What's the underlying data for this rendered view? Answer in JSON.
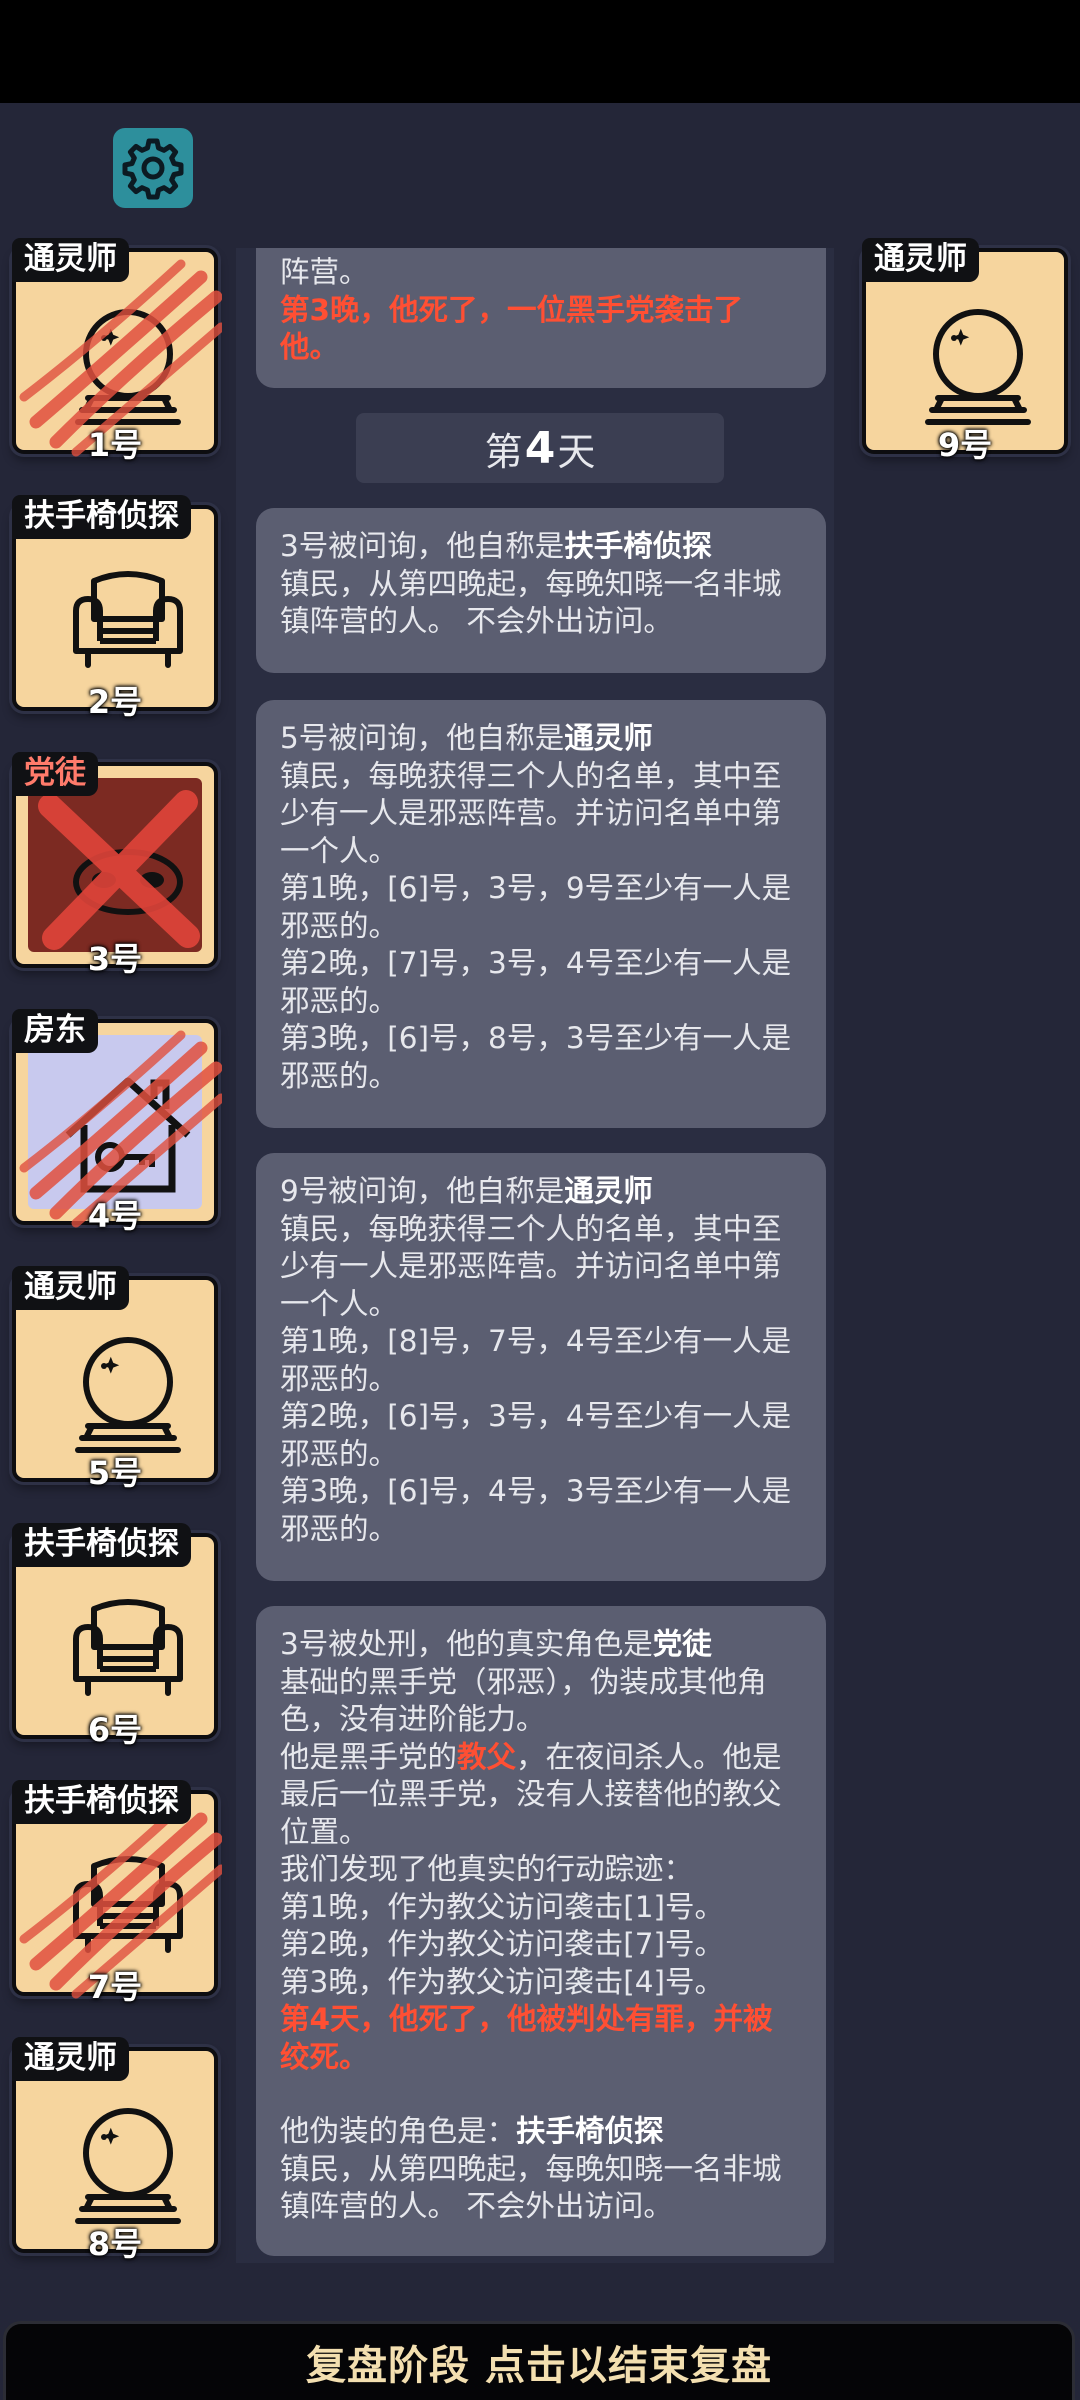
{
  "players_left": [
    {
      "role": "通灵师",
      "seat": "1号",
      "state": "clawed",
      "icon": "crystal-ball-icon"
    },
    {
      "role": "扶手椅侦探",
      "seat": "2号",
      "state": "normal",
      "icon": "armchair-icon"
    },
    {
      "role": "党徒",
      "seat": "3号",
      "state": "executed",
      "icon": "mask-icon"
    },
    {
      "role": "房东",
      "seat": "4号",
      "state": "clawed",
      "icon": "house-key-icon"
    },
    {
      "role": "通灵师",
      "seat": "5号",
      "state": "normal",
      "icon": "crystal-ball-icon"
    },
    {
      "role": "扶手椅侦探",
      "seat": "6号",
      "state": "normal",
      "icon": "armchair-icon"
    },
    {
      "role": "扶手椅侦探",
      "seat": "7号",
      "state": "clawed",
      "icon": "armchair-icon"
    },
    {
      "role": "通灵师",
      "seat": "8号",
      "state": "normal",
      "icon": "crystal-ball-icon"
    }
  ],
  "players_right": [
    {
      "role": "通灵师",
      "seat": "9号",
      "state": "normal",
      "icon": "crystal-ball-icon"
    }
  ],
  "log": {
    "card0": {
      "line1": "阵营。",
      "death": "第3晚，他死了，一位黑手党袭击了他。"
    },
    "day": {
      "prefix": "第",
      "num": "4",
      "suffix": "天"
    },
    "card1": {
      "lead": "3号被问询，他自称是",
      "role": "扶手椅侦探",
      "body": "镇民，从第四晚起，每晚知晓一名非城镇阵营的人。 不会外出访问。"
    },
    "card2": {
      "lead": "5号被问询，他自称是",
      "role": "通灵师",
      "body": "镇民，每晚获得三个人的名单，其中至少有一人是邪恶阵营。并访问名单中第一个人。\n第1晚，[6]号，3号，9号至少有一人是邪恶的。\n第2晚，[7]号，3号，4号至少有一人是邪恶的。\n第3晚，[6]号，8号，3号至少有一人是邪恶的。"
    },
    "card3": {
      "lead": "9号被问询，他自称是",
      "role": "通灵师",
      "body": "镇民，每晚获得三个人的名单，其中至少有一人是邪恶阵营。并访问名单中第一个人。\n第1晚，[8]号，7号，4号至少有一人是邪恶的。\n第2晚，[6]号，3号，4号至少有一人是邪恶的。\n第3晚，[6]号，4号，3号至少有一人是邪恶的。"
    },
    "card4": {
      "lead": "3号被处刑，他的真实角色是",
      "role": "党徒",
      "body1": "基础的黑手党（邪恶），伪装成其他角色，没有进阶能力。\n他是黑手党的",
      "godfather": "教父",
      "body2": "，在夜间杀人。他是最后一位黑手党，没有人接替他的教父位置。\n我们发现了他真实的行动踪迹：\n第1晚，作为教父访问袭击[1]号。\n第2晚，作为教父访问袭击[7]号。\n第3晚，作为教父访问袭击[4]号。",
      "death": "第4天，他死了，他被判处有罪，并被绞死。",
      "disguise_lead": "他伪装的角色是：",
      "disguise_role": "扶手椅侦探",
      "disguise_body": "镇民，从第四晚起，每晚知晓一名非城镇阵营的人。 不会外出访问。"
    }
  },
  "bottom_bar": {
    "label": "复盘阶段 点击以结束复盘"
  },
  "colors": {
    "accent_red": "#ff4f33",
    "card_bg": "#5b5e71",
    "tile_bg": "#f6d59e",
    "settings_bg": "#2d8f9c"
  }
}
